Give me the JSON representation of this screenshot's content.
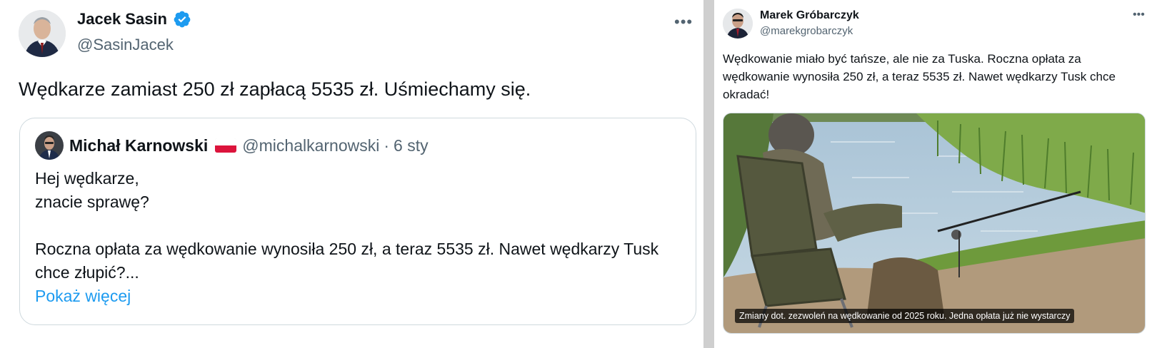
{
  "left_tweet": {
    "author_name": "Jacek Sasin",
    "author_handle": "@SasinJacek",
    "more_icon": "more-horizontal-icon",
    "text": "Wędkarze zamiast 250 zł zapłacą 5535 zł. Uśmiechamy się.",
    "quote": {
      "author_name": "Michał Karnowski",
      "author_handle": "@michalkarnowski",
      "separator": "·",
      "date": "6 sty",
      "body": "Hej wędkarze,\nznacie sprawę?\n\nRoczna opłata za wędkowanie wynosiła 250 zł, a teraz 5535 zł. Nawet wędkarzy Tusk chce złupić?...",
      "show_more": "Pokaż więcej"
    }
  },
  "right_tweet": {
    "author_name": "Marek Gróbarczyk",
    "author_handle": "@marekgrobarczyk",
    "more_icon": "more-horizontal-icon",
    "text": "Wędkowanie miało być tańsze, ale nie za Tuska. Roczna opłata za wędkowanie wynosiła 250 zł, a teraz 5535 zł. Nawet wędkarzy Tusk chce okradać!",
    "media_caption": "Zmiany dot. zezwoleń na wędkowanie od 2025 roku. Jedna opłata już nie wystarczy"
  },
  "colors": {
    "text": "#0f1419",
    "secondary": "#536471",
    "link": "#1d9bf0",
    "verified": "#1d9bf0",
    "border": "#cfd9de"
  }
}
